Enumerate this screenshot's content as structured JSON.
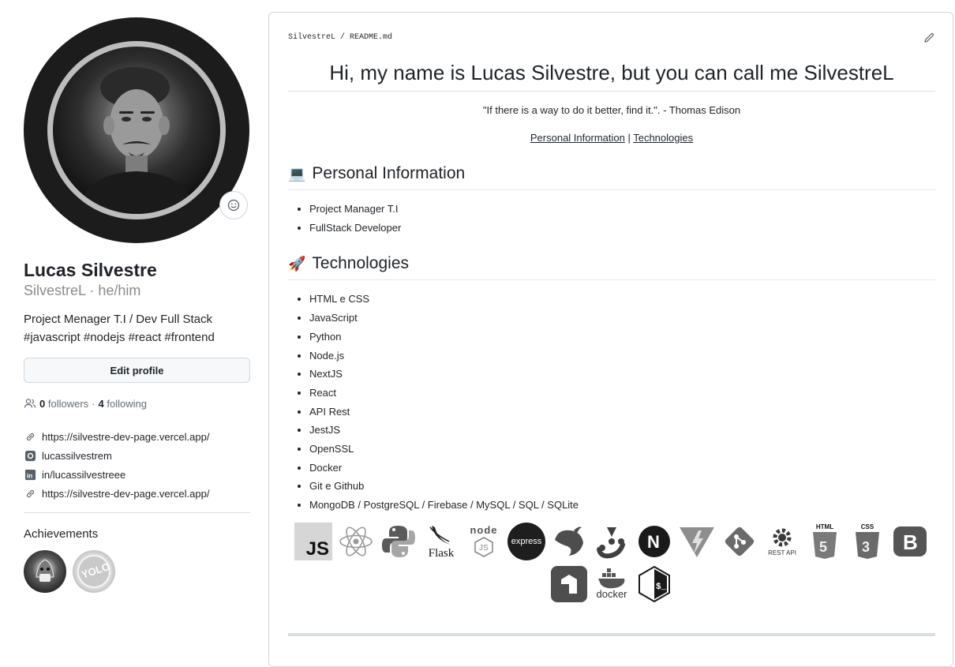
{
  "profile": {
    "name": "Lucas Silvestre",
    "login_line": "SilvestreL · he/him",
    "bio_line1": "Project Menager T.I / Dev Full Stack",
    "bio_line2": "#javascript #nodejs #react #frontend",
    "edit_label": "Edit profile",
    "followers_count": "0",
    "followers_label": "followers",
    "dot": "·",
    "following_count": "4",
    "following_label": "following",
    "links": [
      {
        "icon": "link-icon",
        "text": "https://silvestre-dev-page.vercel.app/"
      },
      {
        "icon": "instagram-icon",
        "text": "lucassilvestrem"
      },
      {
        "icon": "linkedin-icon",
        "text": "in/lucassilvestreee"
      },
      {
        "icon": "link-icon",
        "text": "https://silvestre-dev-page.vercel.app/"
      }
    ],
    "achievements_title": "Achievements",
    "badges": [
      "shark-badge",
      "yolo-badge"
    ]
  },
  "readme": {
    "breadcrumb": "SilvestreL / README.md",
    "title": "Hi, my name is Lucas Silvestre, but you can call me SilvestreL",
    "quote": "\"If there is a way to do it better, find it.\". - Thomas Edison",
    "nav_link1": "Personal Information",
    "nav_sep": " | ",
    "nav_link2": "Technologies",
    "section1": {
      "emoji": "💻",
      "title": "Personal Information",
      "items": [
        "Project Manager T.I",
        "FullStack Developer"
      ]
    },
    "section2": {
      "emoji": "🚀",
      "title": "Technologies",
      "items": [
        "HTML e CSS",
        "JavaScript",
        "Python",
        "Node.js",
        "NextJS",
        "React",
        "API Rest",
        "JestJS",
        "OpenSSL",
        "Docker",
        "Git e Github",
        "MongoDB / PostgreSQL / Firebase / MySQL / SQL / SQLite"
      ]
    },
    "tech_icons_row1": [
      "js-icon",
      "react-icon",
      "python-icon",
      "flask-icon",
      "nodejs-icon",
      "express-icon",
      "nestjs-icon",
      "jest-icon",
      "nextjs-icon",
      "vite-icon",
      "git-icon",
      "rest-api-icon",
      "html5-icon",
      "css3-icon",
      "bootstrap-icon"
    ],
    "tech_icons_row2": [
      "firebase-icon",
      "docker-icon",
      "bash-icon"
    ],
    "icon_texts": {
      "js": "JS",
      "flask": "Flask",
      "node": "node",
      "express": "express",
      "next": "N",
      "rest": "REST API",
      "html": "HTML",
      "css": "CSS",
      "bootstrap": "B",
      "docker": "docker",
      "bash": "$_"
    }
  }
}
